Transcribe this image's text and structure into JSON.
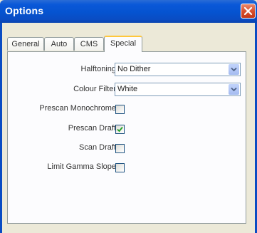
{
  "window": {
    "title": "Options"
  },
  "tabs": [
    {
      "label": "General",
      "active": false
    },
    {
      "label": "Auto",
      "active": false
    },
    {
      "label": "CMS",
      "active": false
    },
    {
      "label": "Special",
      "active": true
    }
  ],
  "special": {
    "halftoning": {
      "label": "Halftoning",
      "value": "No Dither"
    },
    "colour_filter": {
      "label": "Colour Filter",
      "value": "White"
    },
    "prescan_monochrome": {
      "label": "Prescan Monochrome",
      "checked": false
    },
    "prescan_draft": {
      "label": "Prescan Draft",
      "checked": true
    },
    "scan_draft": {
      "label": "Scan Draft",
      "checked": false
    },
    "limit_gamma_slope": {
      "label": "Limit Gamma Slope",
      "checked": false
    }
  },
  "colors": {
    "titlebar": "#0553d0",
    "close_button": "#d8502e",
    "active_tab_highlight": "#ffc73c",
    "checkbox_check": "#21a121"
  },
  "icons": [
    "close-icon",
    "chevron-down-icon",
    "checkmark-icon"
  ]
}
